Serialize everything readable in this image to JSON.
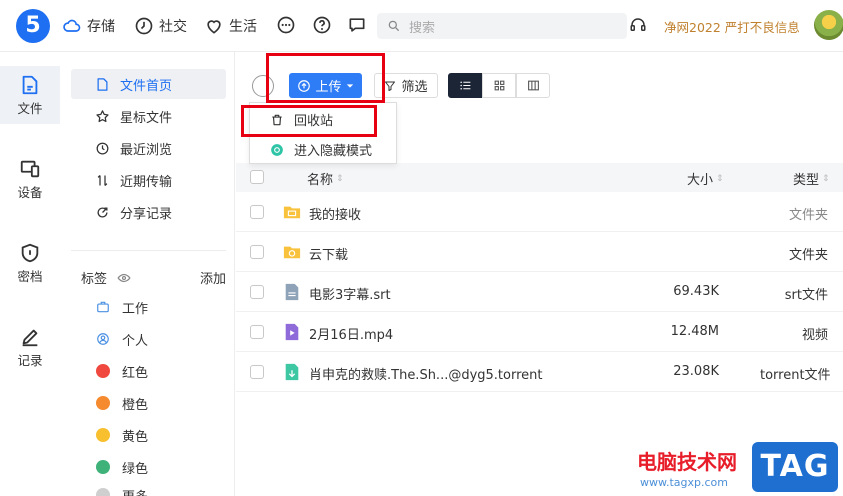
{
  "topbar": {
    "logo_text": "5",
    "nav": [
      {
        "icon": "cloud-icon",
        "label": "存储"
      },
      {
        "icon": "clock-icon",
        "label": "社交"
      },
      {
        "icon": "heart-icon",
        "label": "生活"
      }
    ],
    "search_placeholder": "搜索",
    "notice": "净网2022 严打不良信息"
  },
  "rail": {
    "items": [
      {
        "icon": "file-icon",
        "label": "文件"
      },
      {
        "icon": "device-icon",
        "label": "设备"
      },
      {
        "icon": "shield-icon",
        "label": "密档"
      },
      {
        "icon": "pen-icon",
        "label": "记录"
      }
    ]
  },
  "sidebar": {
    "items": [
      {
        "icon": "document-icon",
        "label": "文件首页"
      },
      {
        "icon": "star-icon",
        "label": "星标文件"
      },
      {
        "icon": "history-icon",
        "label": "最近浏览"
      },
      {
        "icon": "transfer-icon",
        "label": "近期传输"
      },
      {
        "icon": "share-icon",
        "label": "分享记录"
      }
    ],
    "tags_title": "标签",
    "tags_add": "添加",
    "tags": [
      {
        "label": "工作",
        "color": "#4a90e2",
        "icon": "briefcase-icon"
      },
      {
        "label": "个人",
        "color": "#4a90e2",
        "icon": "person-icon"
      },
      {
        "label": "红色",
        "color": "#f0483e"
      },
      {
        "label": "橙色",
        "color": "#f58a2e"
      },
      {
        "label": "黄色",
        "color": "#f8bf2f"
      },
      {
        "label": "绿色",
        "color": "#3fb27a"
      },
      {
        "label": "更多",
        "color": "#cfcfcf"
      }
    ]
  },
  "toolbar": {
    "upload_label": "上传",
    "filter_label": "筛选"
  },
  "dropdown": {
    "items": [
      {
        "icon": "trash-icon",
        "label": "回收站"
      },
      {
        "icon": "hidden-mode-icon",
        "label": "进入隐藏模式"
      }
    ]
  },
  "table": {
    "headers": {
      "name": "名称",
      "size": "大小",
      "type": "类型"
    },
    "rows": [
      {
        "icon": "folder-inbox-icon",
        "name": "我的接收",
        "size": "",
        "type": "文件夹"
      },
      {
        "icon": "folder-download-icon",
        "name": "云下载",
        "size": "",
        "type": "文件夹"
      },
      {
        "icon": "srt-file-icon",
        "name": "电影3字幕.srt",
        "size": "69.43K",
        "type": "srt文件"
      },
      {
        "icon": "video-file-icon",
        "name": "2月16日.mp4",
        "size": "12.48M",
        "type": "视频"
      },
      {
        "icon": "torrent-file-icon",
        "name": "肖申克的救赎.The.Sh...@dyg5.torrent",
        "size": "23.08K",
        "type": "torrent文件"
      }
    ]
  },
  "watermark": {
    "site": "电脑技术网",
    "url": "www.tagxp.com",
    "logo": "TAG"
  },
  "colors": {
    "accent": "#2f7df6",
    "highlight_box": "#e60012",
    "notice": "#c0812f"
  }
}
